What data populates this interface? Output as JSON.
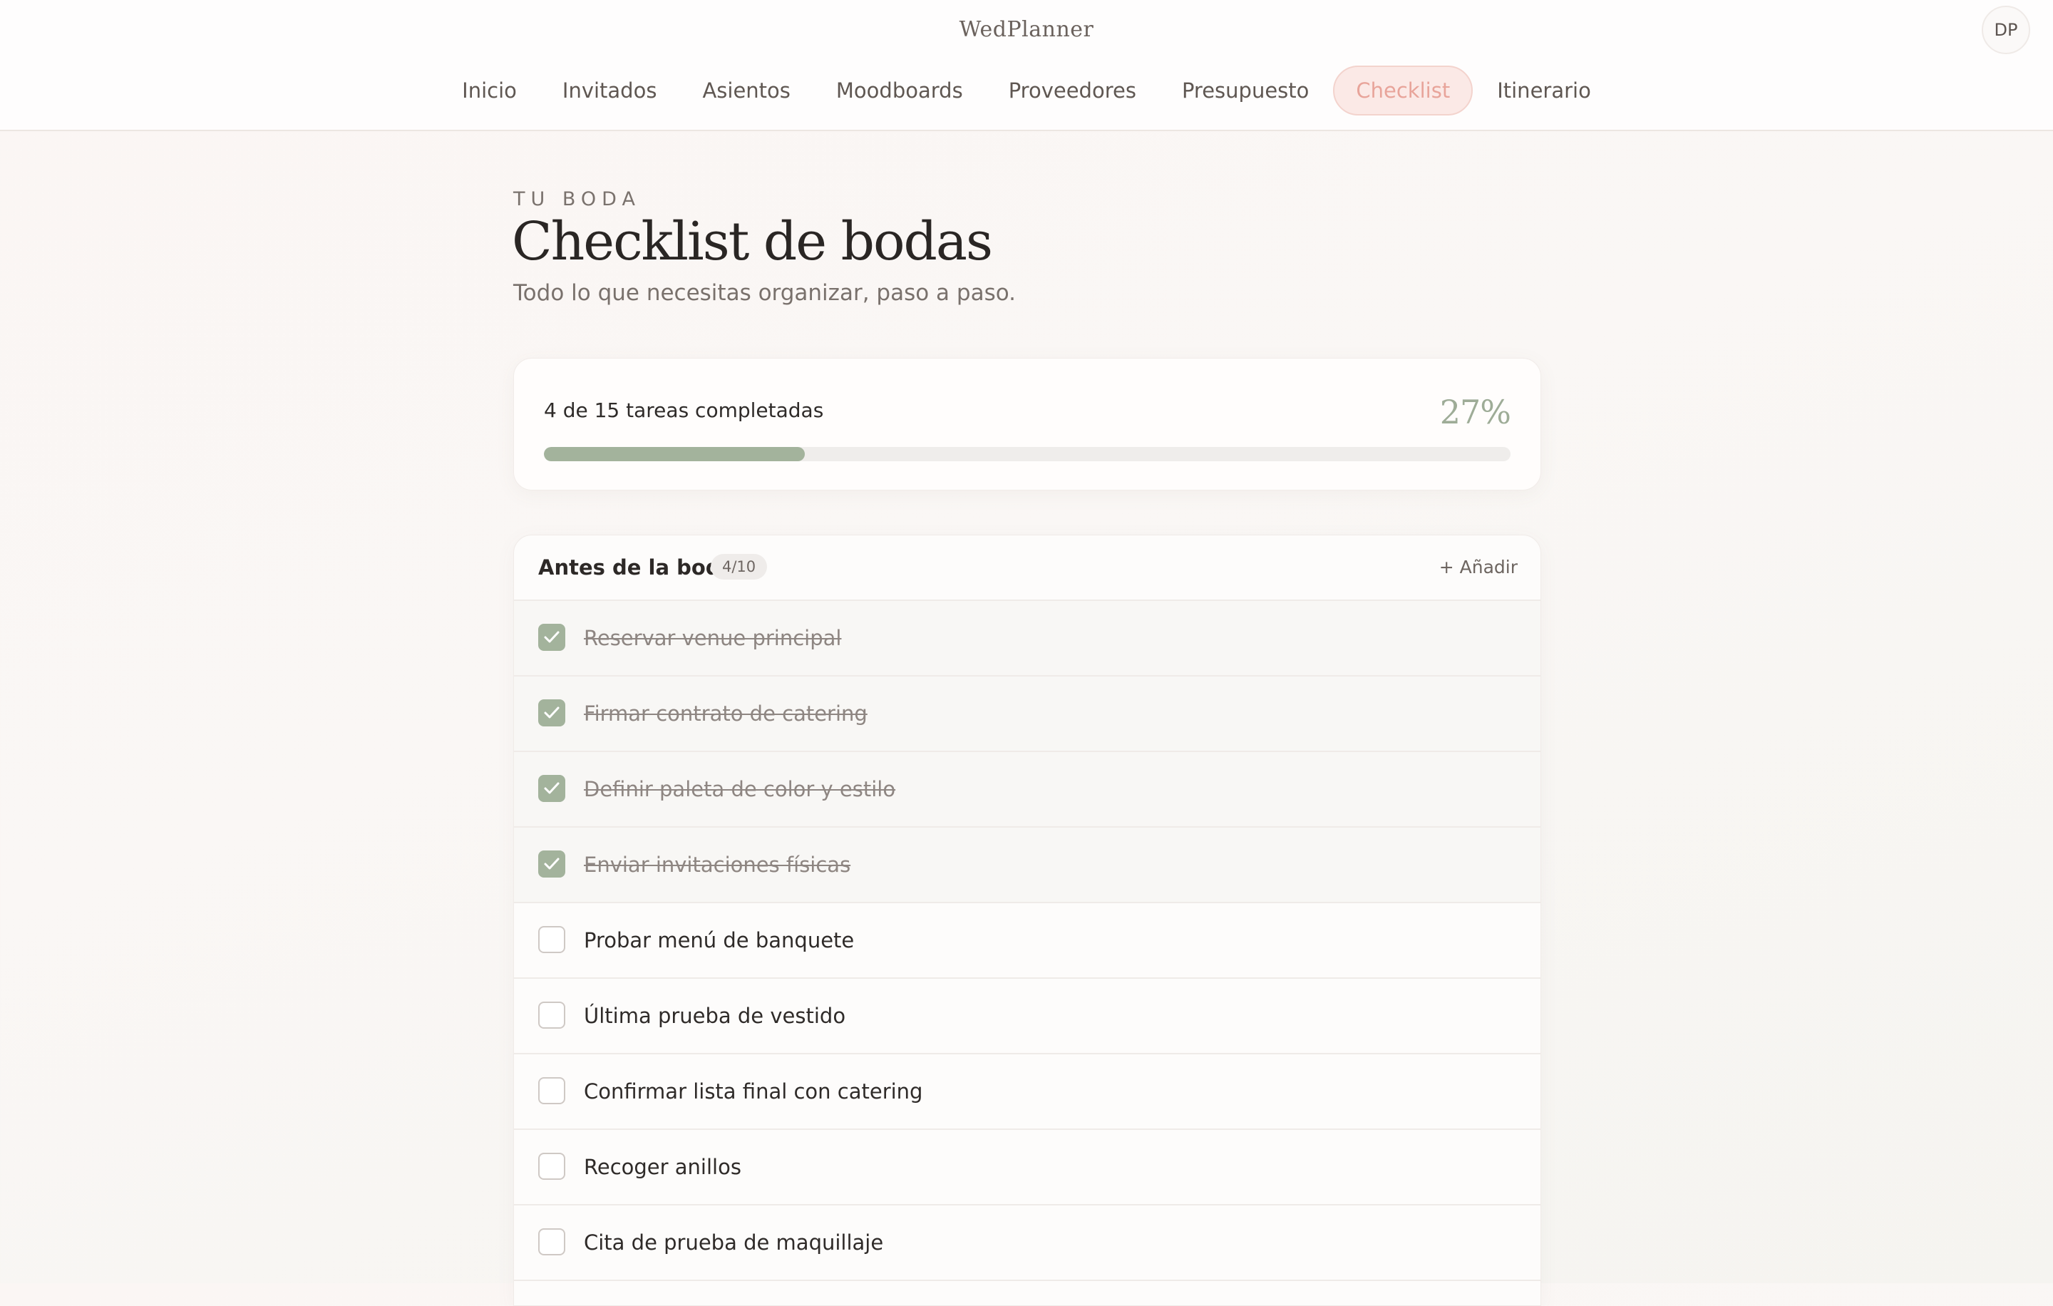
{
  "header": {
    "brand": "WedPlanner",
    "avatar_initials": "DP",
    "nav": [
      {
        "label": "Inicio",
        "active": false
      },
      {
        "label": "Invitados",
        "active": false
      },
      {
        "label": "Asientos",
        "active": false
      },
      {
        "label": "Moodboards",
        "active": false
      },
      {
        "label": "Proveedores",
        "active": false
      },
      {
        "label": "Presupuesto",
        "active": false
      },
      {
        "label": "Checklist",
        "active": true
      },
      {
        "label": "Itinerario",
        "active": false
      }
    ]
  },
  "page": {
    "eyebrow": "TU BODA",
    "title": "Checklist de bodas",
    "subtitle": "Todo lo que necesitas organizar, paso a paso."
  },
  "progress": {
    "summary": "4 de 15 tareas completadas",
    "percent_label": "27%",
    "fraction": 0.27
  },
  "section": {
    "title": "Antes de la boda",
    "count": "4/10",
    "add_label": "+ Añadir",
    "tasks": [
      {
        "label": "Reservar venue principal",
        "done": true
      },
      {
        "label": "Firmar contrato de catering",
        "done": true
      },
      {
        "label": "Definir paleta de color y estilo",
        "done": true
      },
      {
        "label": "Enviar invitaciones físicas",
        "done": true
      },
      {
        "label": "Probar menú de banquete",
        "done": false
      },
      {
        "label": "Última prueba de vestido",
        "done": false
      },
      {
        "label": "Confirmar lista final con catering",
        "done": false
      },
      {
        "label": "Recoger anillos",
        "done": false
      },
      {
        "label": "Cita de prueba de maquillaje",
        "done": false
      }
    ]
  },
  "colors": {
    "accent_pink": "#e8a49a",
    "accent_sage": "#a3b39c"
  }
}
